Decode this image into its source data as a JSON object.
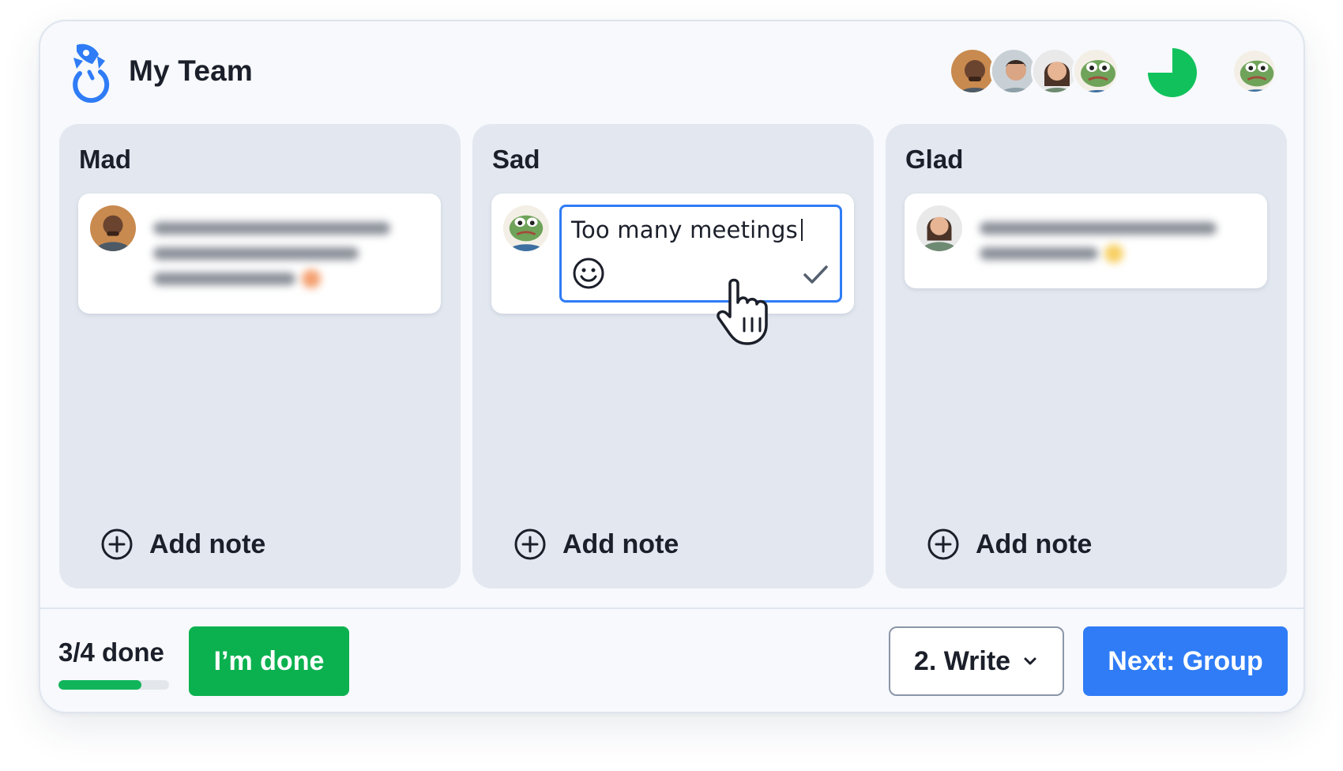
{
  "header": {
    "team_name": "My Team",
    "participants": [
      {
        "name": "participant-1",
        "skin": "#6b4430"
      },
      {
        "name": "participant-2",
        "skin": "#d9a584"
      },
      {
        "name": "participant-3",
        "skin": "#e7b594"
      },
      {
        "name": "participant-4",
        "skin": "#6fa35a"
      }
    ],
    "timer_icon": "pie-timer-icon",
    "timer_remaining_fraction": 0.75,
    "timer_color": "#11c25c"
  },
  "columns": [
    {
      "title": "Mad",
      "add_label": "Add note",
      "note": {
        "text": "",
        "accent": "#f4a070"
      }
    },
    {
      "title": "Sad",
      "add_label": "Add note",
      "note": {
        "editing_text": "Too many meetings"
      }
    },
    {
      "title": "Glad",
      "add_label": "Add note",
      "note": {
        "text": "",
        "accent": "#f7cf62"
      }
    }
  ],
  "footer": {
    "progress_label": "3/4 done",
    "progress_fraction": 0.75,
    "done_label": "I’m done",
    "phase_label": "2. Write",
    "next_label": "Next: Group"
  },
  "colors": {
    "brand_blue": "#2f7cf6",
    "done_green": "#0bb14f",
    "column_bg": "#e3e8f0"
  }
}
